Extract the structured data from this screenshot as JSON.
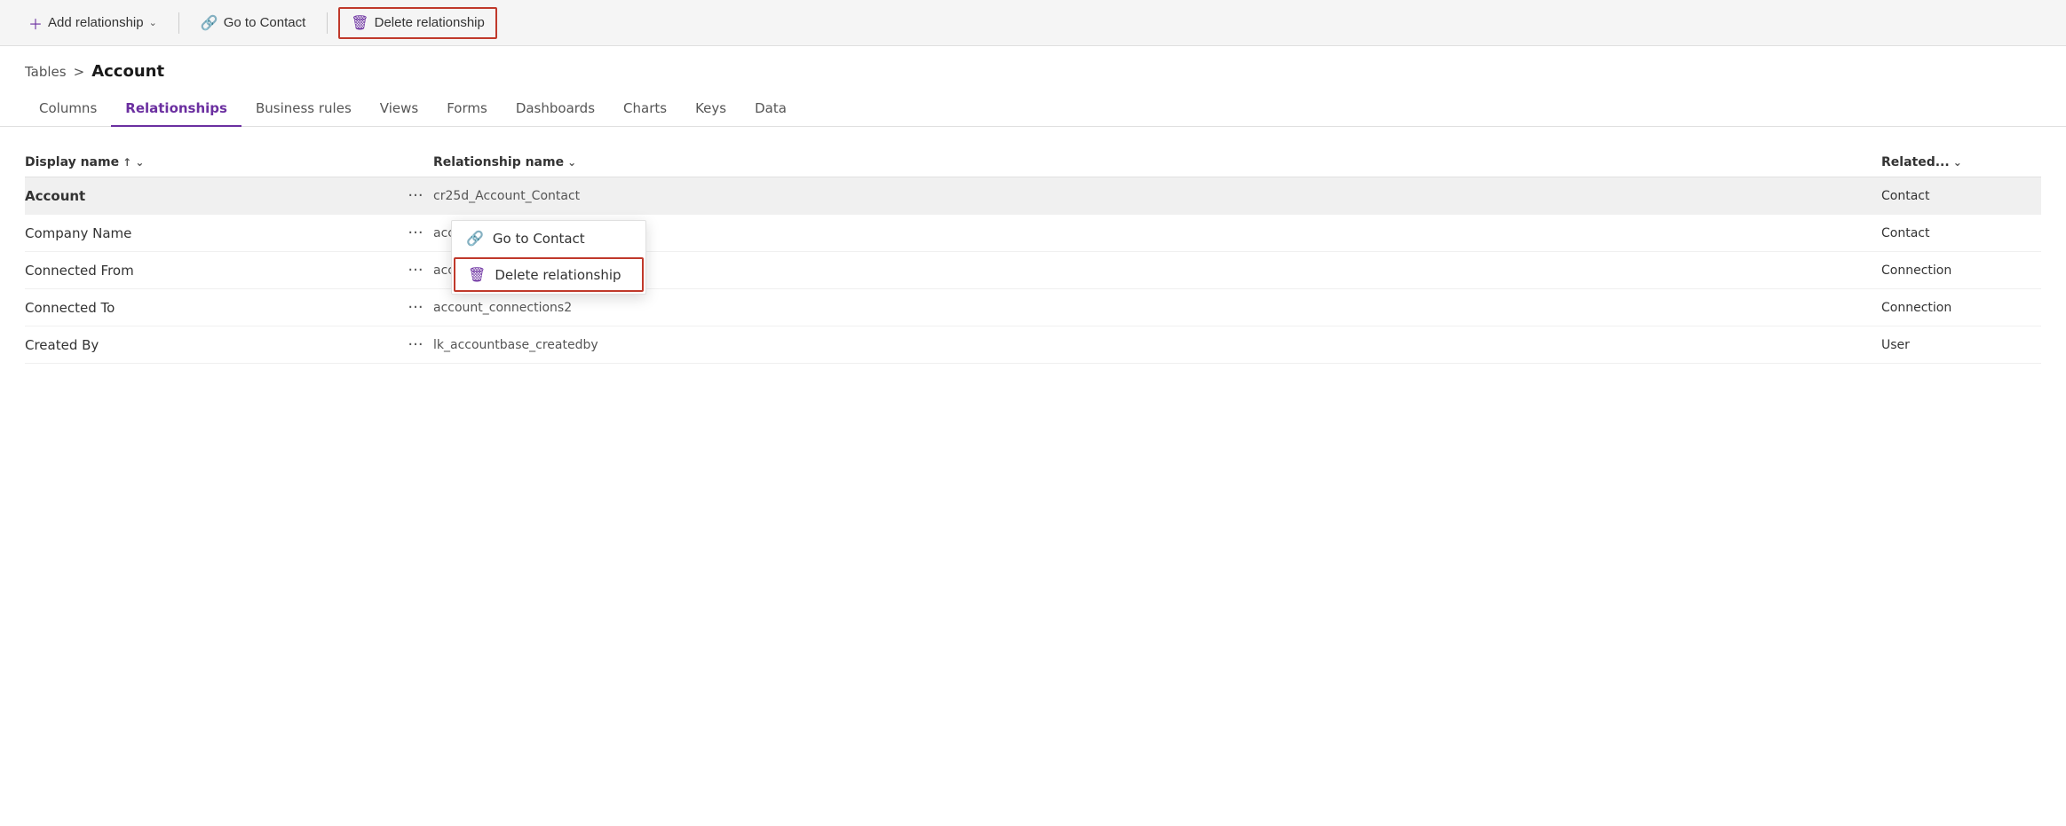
{
  "toolbar": {
    "add_relationship_label": "Add relationship",
    "go_to_contact_label": "Go to Contact",
    "delete_relationship_label": "Delete relationship"
  },
  "breadcrumb": {
    "tables_label": "Tables",
    "separator": ">",
    "current_label": "Account"
  },
  "tabs": [
    {
      "id": "columns",
      "label": "Columns",
      "active": false
    },
    {
      "id": "relationships",
      "label": "Relationships",
      "active": true
    },
    {
      "id": "business-rules",
      "label": "Business rules",
      "active": false
    },
    {
      "id": "views",
      "label": "Views",
      "active": false
    },
    {
      "id": "forms",
      "label": "Forms",
      "active": false
    },
    {
      "id": "dashboards",
      "label": "Dashboards",
      "active": false
    },
    {
      "id": "charts",
      "label": "Charts",
      "active": false
    },
    {
      "id": "keys",
      "label": "Keys",
      "active": false
    },
    {
      "id": "data",
      "label": "Data",
      "active": false
    }
  ],
  "table": {
    "col_display_name": "Display name",
    "col_rel_name": "Relationship name",
    "col_related": "Related...",
    "rows": [
      {
        "display_name": "Account",
        "bold": true,
        "dots": "···",
        "rel_name": "cr25d_Account_Contact",
        "related": "Contact",
        "selected": true
      },
      {
        "display_name": "Company Name",
        "bold": false,
        "dots": "···",
        "rel_name": "account_accounts",
        "related": "Contact",
        "selected": false
      },
      {
        "display_name": "Connected From",
        "bold": false,
        "dots": "···",
        "rel_name": "account_connections1",
        "related": "Connection",
        "selected": false
      },
      {
        "display_name": "Connected To",
        "bold": false,
        "dots": "···",
        "rel_name": "account_connections2",
        "related": "Connection",
        "selected": false
      },
      {
        "display_name": "Created By",
        "bold": false,
        "dots": "···",
        "rel_name": "lk_accountbase_createdby",
        "related": "User",
        "selected": false
      }
    ]
  },
  "context_menu": {
    "go_to_contact": "Go to Contact",
    "delete_relationship": "Delete relationship"
  }
}
